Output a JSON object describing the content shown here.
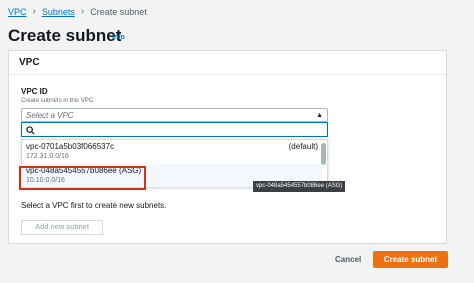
{
  "breadcrumb": {
    "vpc": "VPC",
    "subnets": "Subnets",
    "current": "Create subnet"
  },
  "page": {
    "title": "Create subnet",
    "info": "Info"
  },
  "vpc_panel": {
    "heading": "VPC",
    "field_label": "VPC ID",
    "field_desc": "Create subnets in this VPC.",
    "placeholder": "Select a VPC",
    "options": [
      {
        "id": "vpc-0701a5b03f066537c",
        "tag": "(default)",
        "cidr": "172.31.0.0/16"
      },
      {
        "id": "vpc-048a5454557b086ee (ASG)",
        "tag": "",
        "cidr": "10.10.0.0/16"
      }
    ],
    "tooltip": "vpc-048a5454557b086ee (ASG)"
  },
  "subnet_section": {
    "message": "Select a VPC first to create new subnets.",
    "add_button": "Add new subnet"
  },
  "footer": {
    "cancel": "Cancel",
    "create": "Create subnet"
  },
  "colors": {
    "primary": "#ec7211",
    "link": "#0073bb",
    "highlight_border": "#d13212"
  }
}
